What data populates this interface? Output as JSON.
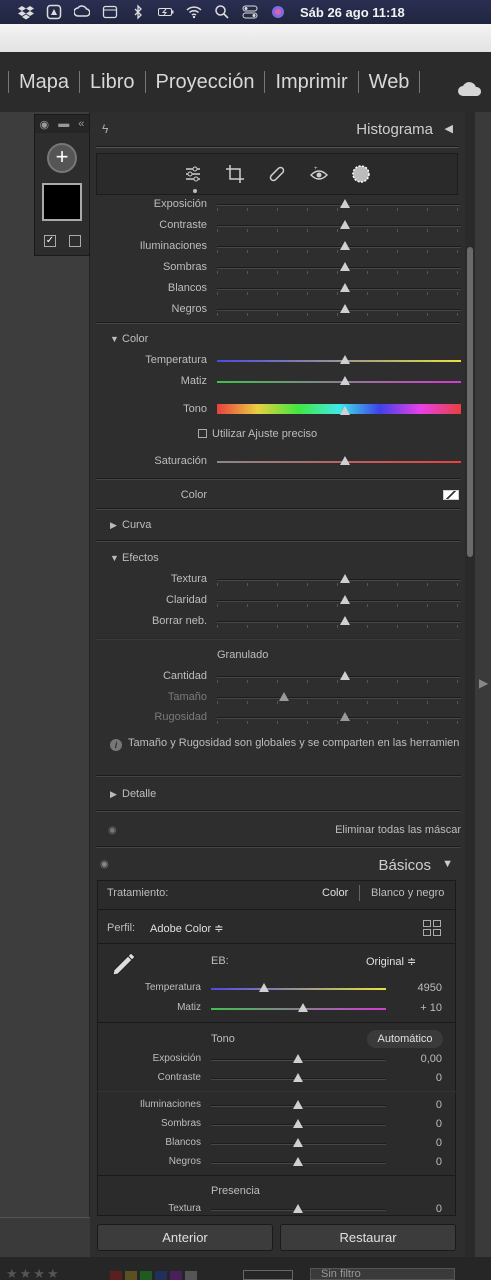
{
  "menubar": {
    "icons": [
      "dropbox-icon",
      "google-drive-icon",
      "creative-cloud-icon",
      "calendar-icon",
      "bluetooth-icon",
      "battery-icon",
      "wifi-icon",
      "search-icon",
      "control-center-icon",
      "siri-icon"
    ],
    "clock": "Sáb 26 ago 11:18"
  },
  "modules": [
    "Mapa",
    "Libro",
    "Proyección",
    "Imprimir",
    "Web"
  ],
  "histogram": {
    "title": "Histograma"
  },
  "mask_panel": {
    "top_rows": [
      {
        "label": "Exposición",
        "pos": 0.53
      },
      {
        "label": "Contraste",
        "pos": 0.53
      },
      {
        "label": "Iluminaciones",
        "pos": 0.53
      },
      {
        "label": "Sombras",
        "pos": 0.53
      },
      {
        "label": "Blancos",
        "pos": 0.53
      },
      {
        "label": "Negros",
        "pos": 0.53
      }
    ],
    "color_section": "Color",
    "color_rows": {
      "temperatura": "Temperatura",
      "matiz": "Matiz",
      "tono": "Tono",
      "saturacion": "Saturación"
    },
    "fine_adjust": "Utilizar Ajuste preciso",
    "color_label": "Color",
    "curva": "Curva",
    "efectos": "Efectos",
    "effect_rows": [
      "Textura",
      "Claridad",
      "Borrar neb."
    ],
    "granulado": "Granulado",
    "grain_rows": [
      {
        "label": "Cantidad",
        "pos": 0.53
      },
      {
        "label": "Tamaño",
        "pos": 0.28
      },
      {
        "label": "Rugosidad",
        "pos": 0.53
      }
    ],
    "info": "Tamaño y Rugosidad son globales y se comparten en las herramien",
    "detalle": "Detalle",
    "remove_masks": "Eliminar todas las máscar"
  },
  "basicos": {
    "title": "Básicos",
    "treatment_label": "Tratamiento:",
    "treatment_color": "Color",
    "treatment_bw": "Blanco y negro",
    "profile_label": "Perfil:",
    "profile_value": "Adobe Color ≑",
    "wb_label": "EB:",
    "wb_value": "Original ≑",
    "temperatura": {
      "label": "Temperatura",
      "value": "4950",
      "pos": 0.3
    },
    "matiz": {
      "label": "Matiz",
      "value": "+ 10",
      "pos": 0.53
    },
    "tono_label": "Tono",
    "auto_label": "Automático",
    "tone_rows": [
      {
        "label": "Exposición",
        "value": "0,00",
        "pos": 0.5
      },
      {
        "label": "Contraste",
        "value": "0",
        "pos": 0.5
      }
    ],
    "light_rows": [
      {
        "label": "Iluminaciones",
        "value": "0",
        "pos": 0.5
      },
      {
        "label": "Sombras",
        "value": "0",
        "pos": 0.5
      },
      {
        "label": "Blancos",
        "value": "0",
        "pos": 0.5
      },
      {
        "label": "Negros",
        "value": "0",
        "pos": 0.5
      }
    ],
    "presencia_label": "Presencia",
    "textura": {
      "label": "Textura",
      "value": "0",
      "pos": 0.5
    }
  },
  "buttons": {
    "previous": "Anterior",
    "reset": "Restaurar"
  },
  "filmstrip": {
    "filter": "Sin filtro"
  }
}
